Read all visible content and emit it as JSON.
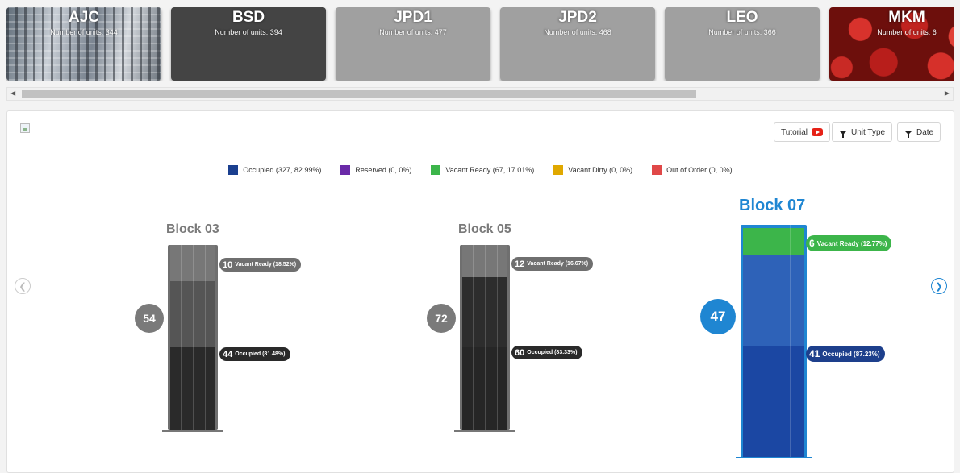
{
  "properties": [
    {
      "name": "AJC",
      "units": "Number of units: 344",
      "style": "photo-building"
    },
    {
      "name": "BSD",
      "units": "Number of units: 394",
      "style": "dark"
    },
    {
      "name": "JPD1",
      "units": "Number of units: 477",
      "style": "grey"
    },
    {
      "name": "JPD2",
      "units": "Number of units: 468",
      "style": "grey"
    },
    {
      "name": "LEO",
      "units": "Number of units: 366",
      "style": "grey"
    },
    {
      "name": "MKM",
      "units": "Number of units: 6",
      "style": "photo-apples"
    }
  ],
  "toolbar": {
    "tutorial": "Tutorial",
    "unit_type": "Unit Type",
    "date": "Date"
  },
  "legend": [
    {
      "label": "Occupied (327, 82.99%)",
      "color": "#1a3f8f"
    },
    {
      "label": "Reserved (0, 0%)",
      "color": "#6a2aa8"
    },
    {
      "label": "Vacant Ready (67, 17.01%)",
      "color": "#3cb54a"
    },
    {
      "label": "Vacant Dirty (0, 0%)",
      "color": "#e0a800"
    },
    {
      "label": "Out of Order (0, 0%)",
      "color": "#e04848"
    }
  ],
  "blocks": [
    {
      "name": "Block 03",
      "total": "54",
      "active": false,
      "vacant_num": "10",
      "vacant_label": "Vacant Ready (18.52%)",
      "occupied_num": "44",
      "occupied_label": "Occupied (81.48%)"
    },
    {
      "name": "Block 05",
      "total": "72",
      "active": false,
      "vacant_num": "12",
      "vacant_label": "Vacant Ready (16.67%)",
      "occupied_num": "60",
      "occupied_label": "Occupied (83.33%)"
    },
    {
      "name": "Block 07",
      "total": "47",
      "active": true,
      "vacant_num": "6",
      "vacant_label": "Vacant Ready (12.77%)",
      "occupied_num": "41",
      "occupied_label": "Occupied (87.23%)"
    }
  ],
  "icons": {
    "prev": "chevron-left-icon",
    "next": "chevron-right-icon",
    "filter": "filter-icon",
    "youtube": "youtube-icon"
  }
}
